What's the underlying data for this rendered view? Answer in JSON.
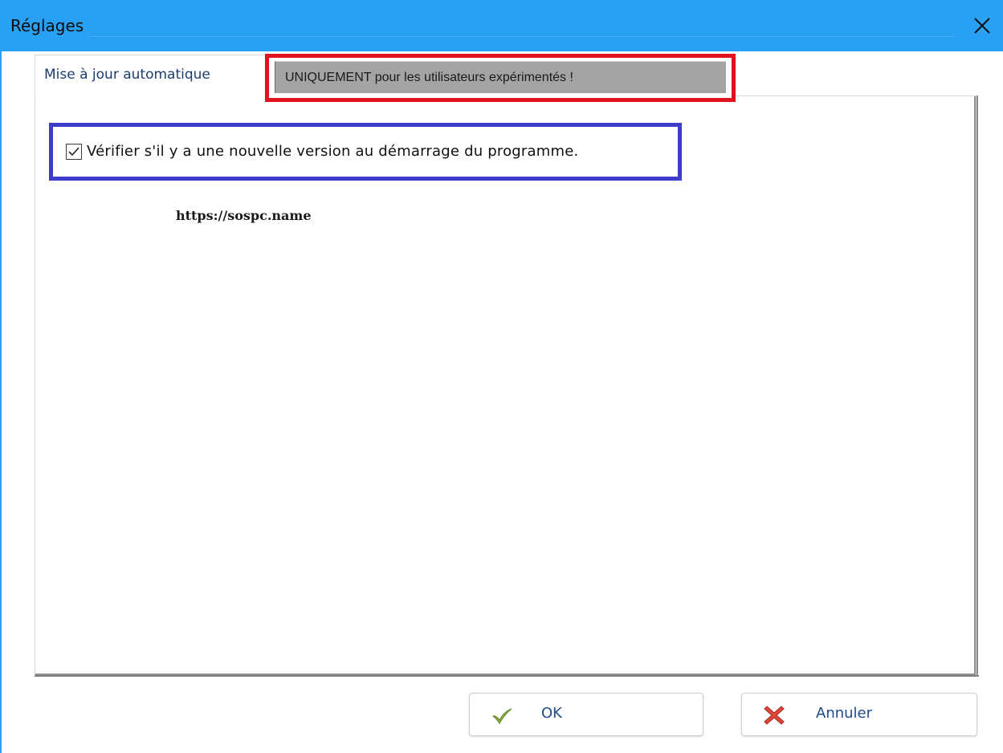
{
  "window": {
    "title": "Réglages",
    "close_icon": "close-icon"
  },
  "tabs": [
    {
      "label": "Mise à jour automatique",
      "active": true
    },
    {
      "label": "UNIQUEMENT pour les utilisateurs expérimentés !",
      "active": false
    }
  ],
  "settings": {
    "check_update_label": "Vérifier s'il y a une nouvelle version au démarrage du programme.",
    "check_update_checked": true,
    "url_text": "https://sospc.name"
  },
  "buttons": {
    "ok_label": "OK",
    "ok_icon": "checkmark-icon",
    "cancel_label": "Annuler",
    "cancel_icon": "red-x-icon"
  },
  "colors": {
    "titlebar": "#28a1f4",
    "red_highlight": "#e1121f",
    "blue_highlight": "#3d3dc9"
  }
}
